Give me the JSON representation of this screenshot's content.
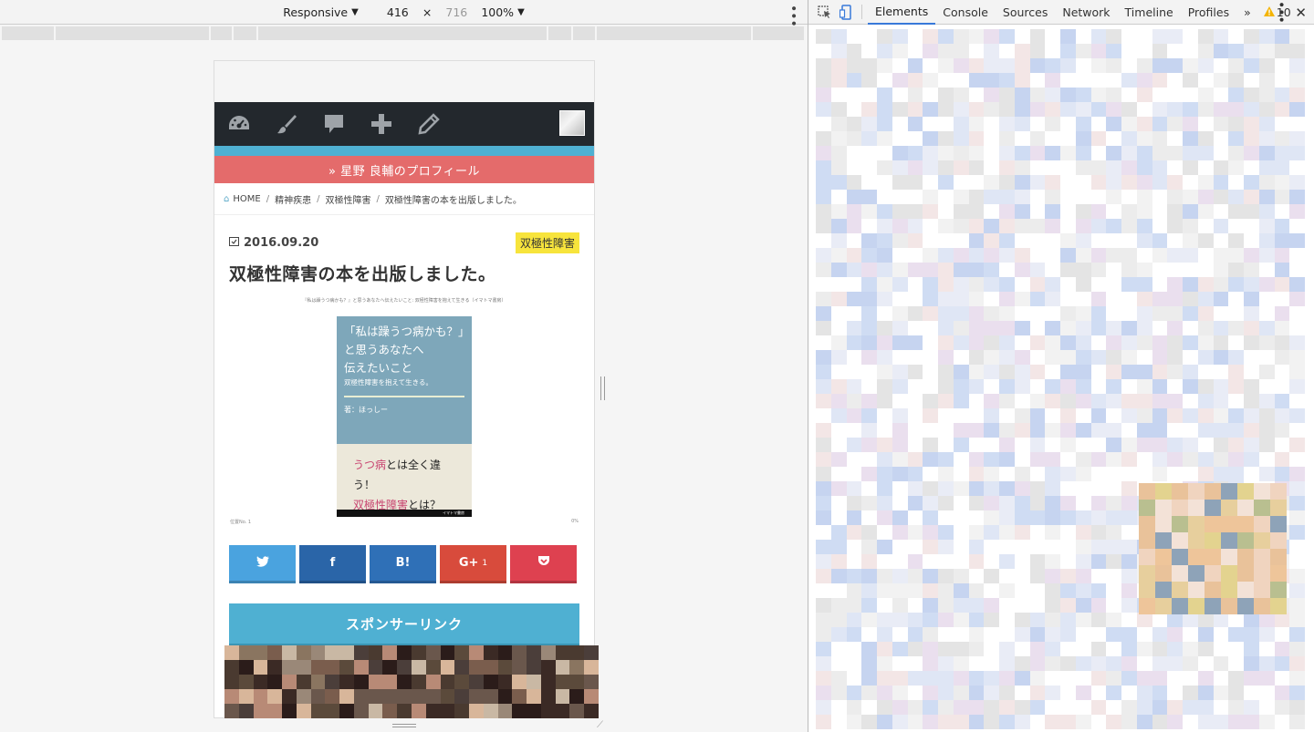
{
  "emulator": {
    "device_mode": "Responsive",
    "width": "416",
    "height": "716",
    "zoom": "100%"
  },
  "site": {
    "profile_link": "» 星野 良輔のプロフィール",
    "breadcrumbs": [
      {
        "label": "HOME"
      },
      {
        "label": "精神疾患"
      },
      {
        "label": "双極性障害"
      },
      {
        "label": "双極性障害の本を出版しました。"
      }
    ],
    "post": {
      "date": "2016.09.20",
      "category": "双極性障害",
      "title": "双極性障害の本を出版しました。",
      "image_caption": "『私は躁うつ病かも？』と思うあなたへ伝えたいこと: 双極性障害を抱えて生きる（イマトマ書房）",
      "book": {
        "line1": "「私は躁うつ病かも？」",
        "line2": "と思うあなたへ",
        "line3": "伝えたいこと",
        "subtitle": "双極性障害を抱えて生きる。",
        "author": "著：ほっしー",
        "tag1_pink": "うつ病",
        "tag1_rest": "とは全く違う！",
        "tag2_pink": "双極性障害",
        "tag2_rest": "とは？",
        "strip": "イマトマ書房"
      },
      "page_left": "位置No. 1",
      "page_right": "0%"
    },
    "share_buttons": [
      {
        "label": "",
        "icon": "twitter-icon",
        "color": "#4aa3df"
      },
      {
        "label": "f",
        "icon": "facebook-icon",
        "color": "#2a65a8"
      },
      {
        "label": "B!",
        "icon": "hatena-icon",
        "color": "#2f70b7"
      },
      {
        "label": "G+",
        "count": "1",
        "icon": "google-plus-icon",
        "color": "#d84b3c"
      },
      {
        "label": "",
        "icon": "pocket-icon",
        "color": "#de4150"
      }
    ],
    "sponsor": "スポンサーリンク"
  },
  "devtools": {
    "tabs": [
      "Elements",
      "Console",
      "Sources",
      "Network",
      "Timeline",
      "Profiles"
    ],
    "active_tab": "Elements",
    "warning_count": "10"
  }
}
